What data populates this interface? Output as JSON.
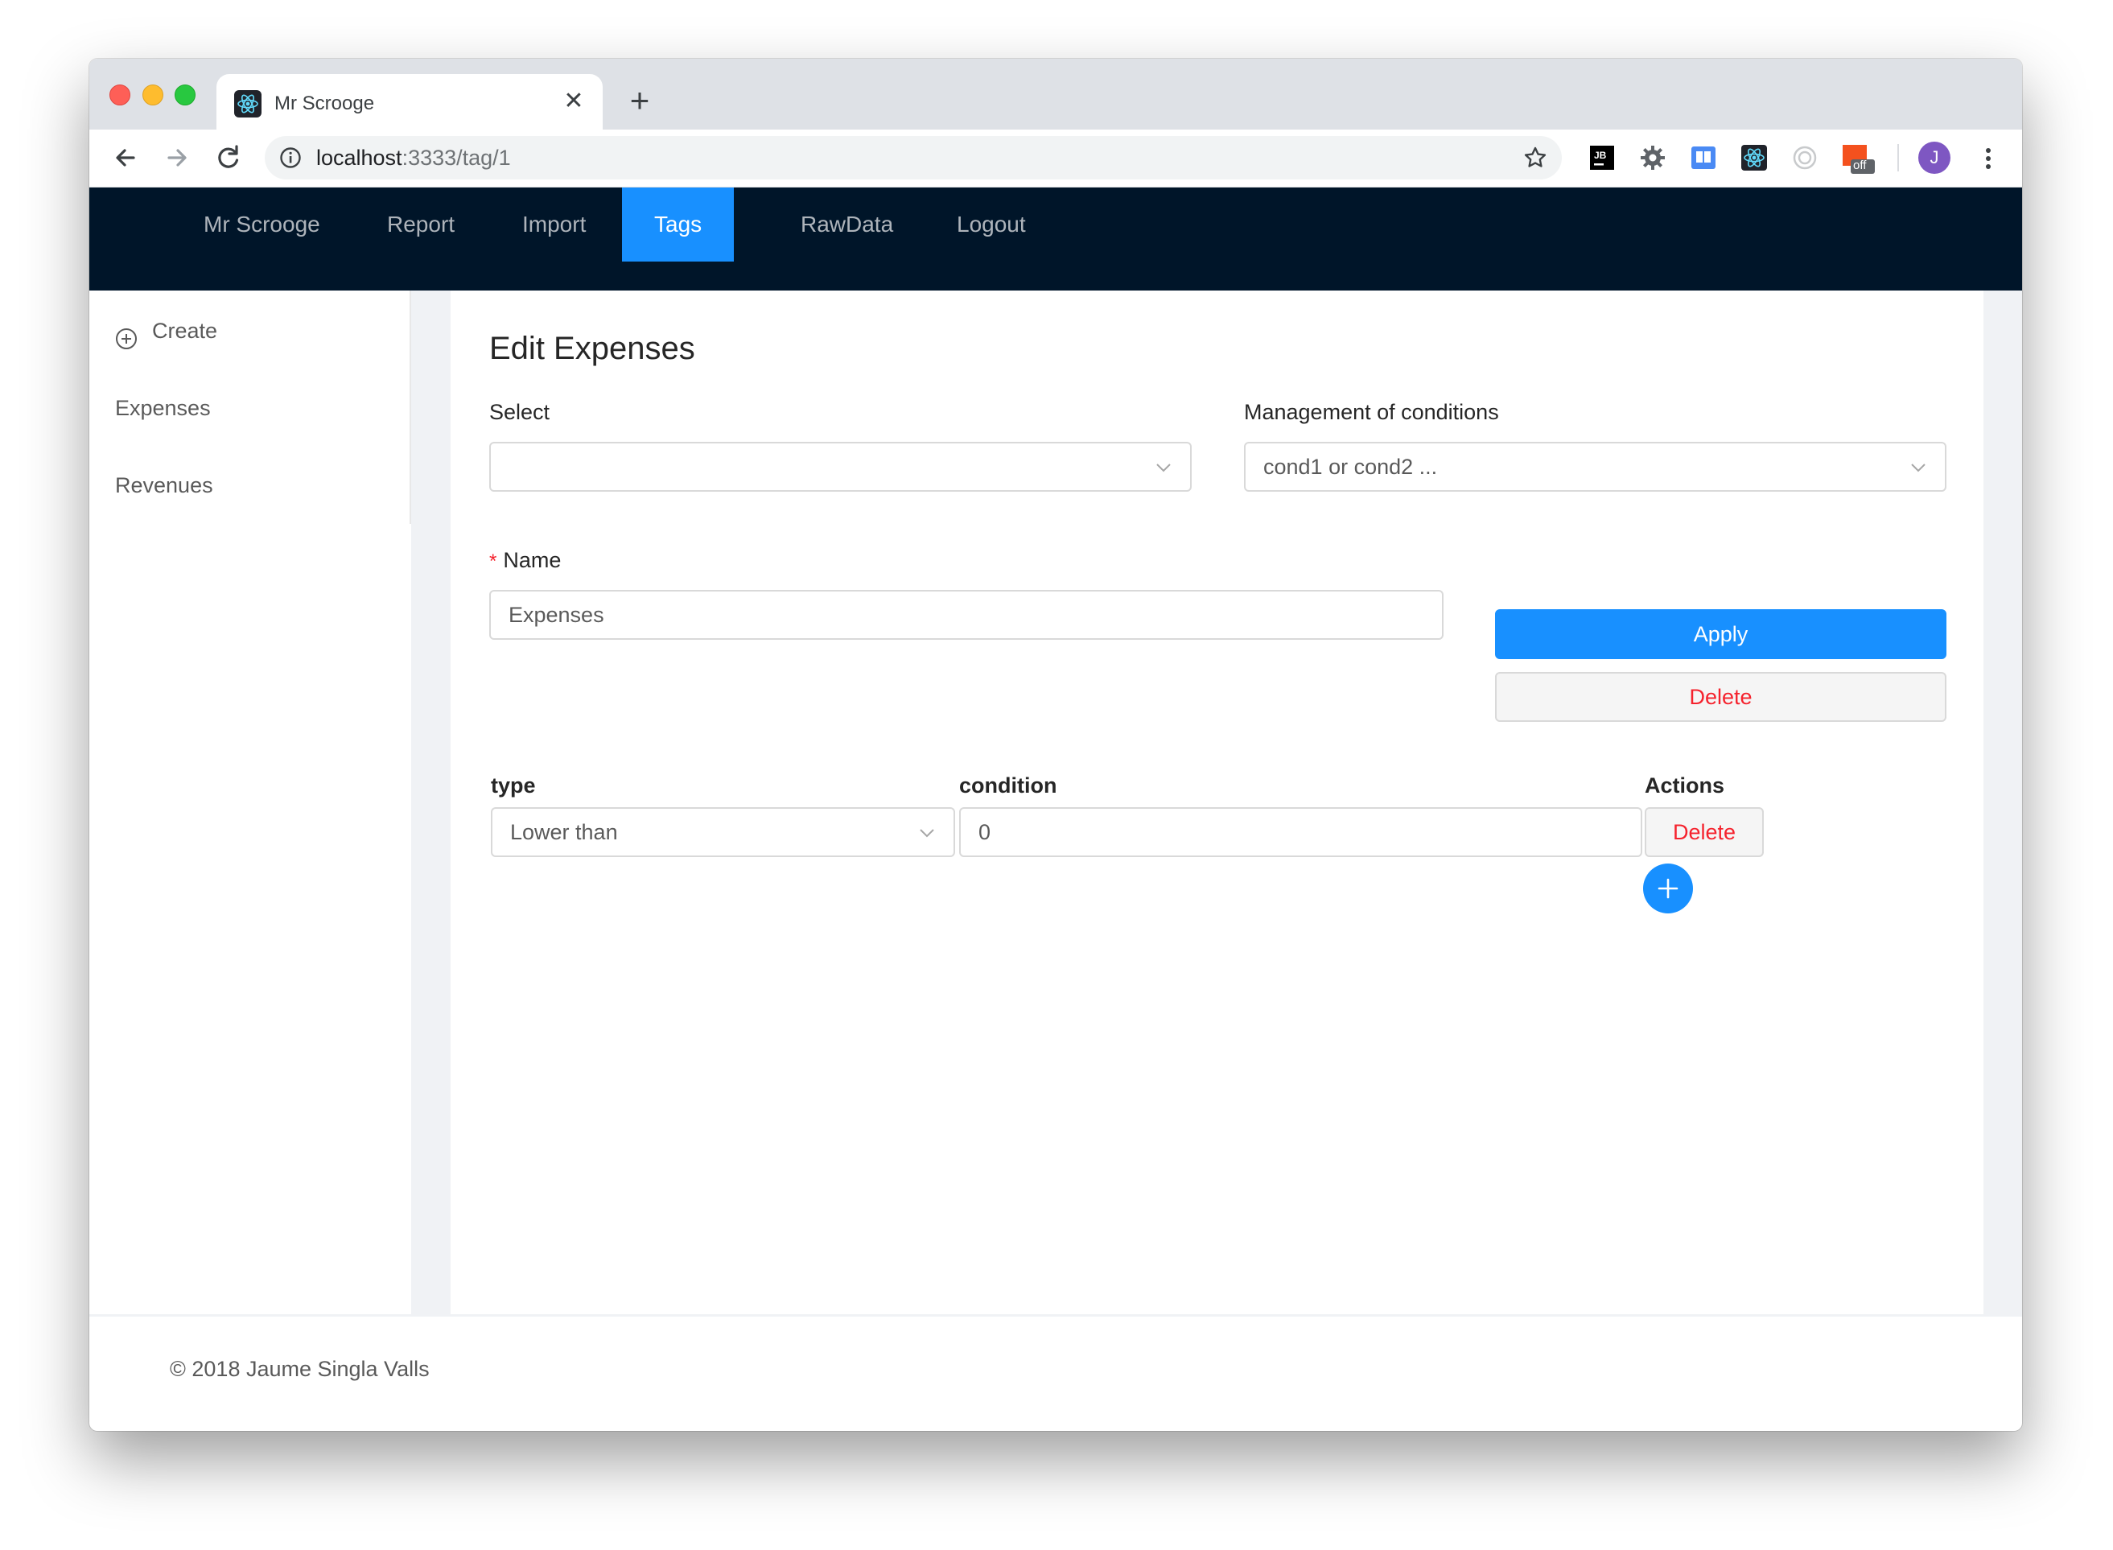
{
  "browser": {
    "tab_title": "Mr Scrooge",
    "tab_close": "✕",
    "new_tab": "+",
    "url_host": "localhost",
    "url_path": ":3333/tag/1",
    "avatar_initial": "J",
    "extension_badge": "off"
  },
  "nav": {
    "items": [
      {
        "label": "Mr Scrooge"
      },
      {
        "label": "Report"
      },
      {
        "label": "Import"
      },
      {
        "label": "Tags"
      },
      {
        "label": "RawData"
      },
      {
        "label": "Logout"
      }
    ],
    "active": "Tags"
  },
  "sidebar": {
    "items": [
      {
        "label": "Create",
        "icon": "plus-circle-icon"
      },
      {
        "label": "Expenses"
      },
      {
        "label": "Revenues"
      }
    ]
  },
  "form": {
    "title": "Edit Expenses",
    "select_label": "Select",
    "select_value": "",
    "conditions_label": "Management of conditions",
    "conditions_value": "cond1 or cond2 ...",
    "name_required_mark": "*",
    "name_label": "Name",
    "name_value": "Expenses",
    "apply_label": "Apply",
    "delete_label": "Delete"
  },
  "conditions_table": {
    "headers": {
      "type": "type",
      "condition": "condition",
      "actions": "Actions"
    },
    "rows": [
      {
        "type": "Lower than",
        "condition": "0",
        "action": "Delete"
      }
    ]
  },
  "footer": {
    "text": "© 2018 Jaume Singla Valls"
  },
  "colors": {
    "header_bg": "#001529",
    "primary": "#1890ff",
    "danger": "#f5222d"
  }
}
